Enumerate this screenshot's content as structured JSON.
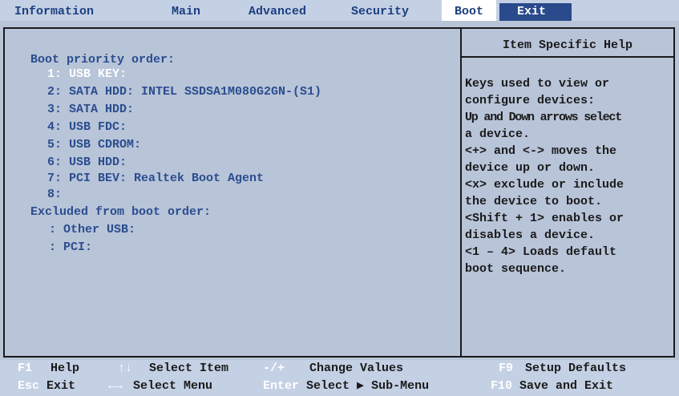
{
  "menu": {
    "tabs": [
      {
        "label": "Information"
      },
      {
        "label": "Main"
      },
      {
        "label": "Advanced"
      },
      {
        "label": "Security"
      },
      {
        "label": "Boot"
      },
      {
        "label": "Exit"
      }
    ],
    "active_tab": "Boot"
  },
  "boot": {
    "priority_heading": "Boot priority order:",
    "priority_items": [
      {
        "label": "1: USB KEY:",
        "selected": true
      },
      {
        "label": "2: SATA HDD: INTEL SSDSA1M080G2GN-(S1)"
      },
      {
        "label": "3: SATA HDD:"
      },
      {
        "label": "4: USB FDC:"
      },
      {
        "label": "5: USB CDROM:"
      },
      {
        "label": "6: USB HDD:"
      },
      {
        "label": "7: PCI BEV: Realtek Boot Agent"
      },
      {
        "label": "8:"
      }
    ],
    "excluded_heading": "Excluded from boot order:",
    "excluded_items": [
      {
        "label": ": Other USB:"
      },
      {
        "label": ": PCI:"
      }
    ]
  },
  "help": {
    "title": "Item Specific Help",
    "lines": [
      "Keys used to view or",
      "configure devices:",
      "Up and Down arrows select",
      "a device.",
      "<+> and <-> moves the",
      "device up or down.",
      "<x> exclude or include",
      "the device to boot.",
      "<Shift + 1> enables or",
      "disables a device.",
      "<1 – 4> Loads default",
      "boot sequence."
    ]
  },
  "keys": {
    "row1": [
      {
        "key": "F1",
        "desc": "Help"
      },
      {
        "key": "↑↓",
        "desc": "Select Item"
      },
      {
        "key": "-/+",
        "desc": "Change Values"
      },
      {
        "key": "F9",
        "desc": "Setup Defaults"
      }
    ],
    "row2": [
      {
        "key": "Esc",
        "desc": "Exit"
      },
      {
        "key": "←→",
        "desc": "Select Menu"
      },
      {
        "key": "Enter",
        "desc": "Select ▶ Sub-Menu"
      },
      {
        "key": "F10",
        "desc": "Save and Exit"
      }
    ]
  },
  "colors": {
    "background": "#b8c4d8",
    "menubar": "#c4d0e4",
    "text_blue": "#2b4d8e",
    "selected_text": "#ffffff",
    "frame": "#1a1a1a"
  }
}
